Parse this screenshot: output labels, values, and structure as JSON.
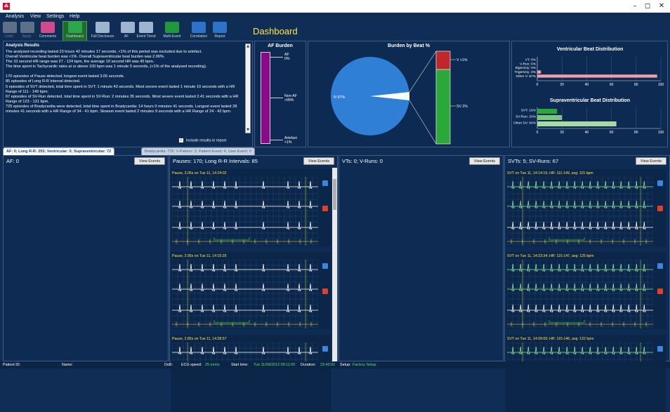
{
  "window": {
    "minimize": "–",
    "restore": "◻",
    "close": "✕"
  },
  "menu": [
    "Analysis",
    "View",
    "Settings",
    "Help"
  ],
  "toolbar": {
    "items": [
      {
        "label": "Undo",
        "icon": "undo-icon",
        "color": "#5e6f88",
        "disabled": true
      },
      {
        "label": "Apply",
        "icon": "gear-icon",
        "color": "#5e6f88",
        "disabled": true
      },
      {
        "label": "Comments",
        "icon": "comment-icon",
        "color": "#d14a8b"
      },
      {
        "label": "Dashboard",
        "icon": "dashboard-icon",
        "color": "#2aa84a",
        "active": true
      },
      {
        "label": "Full Disclosure",
        "icon": "full-disclosure-icon",
        "color": "#9fb4cf"
      },
      {
        "label": "AF",
        "icon": "af-icon",
        "color": "#9fb4cf"
      },
      {
        "label": "Event Trend",
        "icon": "event-trend-icon",
        "color": "#9fb4cf"
      },
      {
        "label": "Multi-Event",
        "icon": "multi-event-icon",
        "color": "#1f9a3a"
      },
      {
        "label": "Correlation",
        "icon": "correlation-icon",
        "color": "#2d74c9"
      },
      {
        "label": "Report",
        "icon": "report-icon",
        "color": "#2d74c9"
      }
    ]
  },
  "title": "Dashboard",
  "analysis": {
    "header": "Analysis Results",
    "lines": [
      "The analysed recording lasted 23 hours 42 minutes 17 seconds, <1% of this period was excluded due to artefact.",
      "Overall Ventricular beat burden was <1%. Overall Supraventricular beat burden was 2.06%.",
      "The 10 second HR range was 27 - 124 bpm, the average 10 second HR was 45 bpm.",
      "The time spent in Tachycardic rates at or above 100 bpm was 1 minute 0 seconds, (<1% of the analysed recording).",
      "",
      "170 episodes of Pause detected, longest event lasted 3.05 seconds.",
      "85 episodes of Long R-R Interval detected.",
      "5 episodes of SVT detected, total time spent in SVT: 1 minute 43 seconds. Most severe event lasted 1 minute 10 seconds with a HR Range of 111 - 149 bpm.",
      "67 episodes of SV-Run detected, total time spent in SV-Run: 2 minutes 35 seconds. Most severe event lasted 2.41 seconds with a HR Range of 123 - 131 bpm.",
      "725 episodes of Bradycardia were detected, total time spent in Bradycardia: 14 hours 0 minutes 41 seconds. Longest event lasted 28 minutes 41 seconds with a HR Range of 34 - 41 bpm. Slowest event lasted 2 minutes 9 seconds with a HR Range of 24 - 42 bpm."
    ],
    "include_label": "Include results in report",
    "include_checked": true,
    "scroll_up": "▲",
    "scroll_down": "▼"
  },
  "af_burden": {
    "title": "AF Burden",
    "af_label": "AF",
    "af_value": "0%",
    "nonaf_label": "Non-AF",
    "nonaf_value": ">99%",
    "artefact_label": "Artefact",
    "artefact_value": "<1%",
    "bar_color": "#8a0a8a"
  },
  "burden_by_beat": {
    "title": "Burden by Beat %",
    "pie_label": "N 97%",
    "v_label": "V <1%",
    "sv_label": "SV 2%",
    "n_fraction": 0.97,
    "colors": {
      "n": "#2f7fd6",
      "v": "#c0262b",
      "sv": "#2aa83a"
    }
  },
  "chart_data": [
    {
      "type": "bar",
      "title": "Ventricular Beat Distribution",
      "categories": [
        "VT: 0%",
        "V-Run: 0%",
        "Bigeminy: 0%",
        "Trigeminy: 3%",
        "Other V: 97%"
      ],
      "values": [
        0,
        0,
        0,
        3,
        97
      ],
      "xlim": [
        0,
        100
      ],
      "ticks": [
        "0",
        "20",
        "40",
        "60",
        "80",
        "100"
      ],
      "color": "#f0a0a8"
    },
    {
      "type": "bar",
      "title": "Supraventricular Beat Distribution",
      "categories": [
        "SVT: 16%",
        "SV-Run: 20%",
        "Other SV: 64%"
      ],
      "values": [
        16,
        20,
        64
      ],
      "xlim": [
        0,
        100
      ],
      "ticks": [
        "0",
        "20",
        "40",
        "60",
        "80",
        "100"
      ],
      "colors": [
        "#2aa83a",
        "#7cc47f",
        "#a8d9a6"
      ]
    }
  ],
  "tabs": [
    {
      "label": "AF: 0; Long R-R: 255; Ventricular: 0; Supraventricular: 72",
      "active": true
    },
    {
      "label": "Bradycardia: 725; V-Pattern: 3; Patient Event: 4; User Event: 0",
      "active": false
    }
  ],
  "columns": [
    {
      "title": "AF: 0",
      "button": "View Events",
      "strips": []
    },
    {
      "title": "Pauses: 170; Long R-R Intervals: 85",
      "button": "View Events",
      "strips": [
        "Pause, 3.05s on Tue 11, 14:24:02",
        "Pause, 2.95s on Tue 11, 14:15:25",
        "Pause, 2.85s on Tue 11, 14:28:57"
      ]
    },
    {
      "title": "VTs: 0; V-Runs: 0",
      "button": "View Events",
      "strips": []
    },
    {
      "title": "SVTs: 5; SV-Runs: 67",
      "button": "View Events",
      "strips": [
        "SVT on Tue 11, 14:14:15; HR: 111-149, avg: 115 bpm",
        "SVT on Tue 11, 14:23:34; HR: 115-147, avg: 125 bpm",
        "SVT on Tue 11, 14:09:00; HR: 115-146, avg: 122 bpm"
      ]
    }
  ],
  "status": {
    "patient_id_label": "Patient ID:",
    "name_label": "Name:",
    "dob_label": "DoB:",
    "ecg_speed_label": "ECG speed:",
    "ecg_speed": "25 mm/s",
    "start_label": "Start time:",
    "start": "Tue 11/09/2012 09:11:00",
    "duration_label": "Duration:",
    "duration": "23:43:02",
    "setup_label": "Setup:",
    "setup": "Factory Setup"
  }
}
